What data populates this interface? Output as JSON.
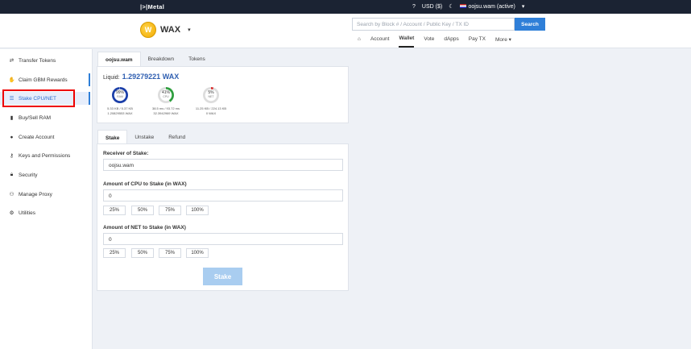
{
  "topbar": {
    "brand": "|>|Metal",
    "help_icon": "help-circle-icon",
    "currency": "USD ($)",
    "theme_icon": "moon-icon",
    "account": "oojsu.wam (active)",
    "caret": "▾"
  },
  "header": {
    "chain_name": "WAX",
    "chain_logo_letter": "W",
    "chain_caret": "▾",
    "search_placeholder": "Search by Block # / Account / Public Key / TX ID",
    "search_button": "Search",
    "nav": [
      "Account",
      "Wallet",
      "Vote",
      "dApps",
      "Pay TX",
      "More ▾"
    ],
    "nav_active": "Wallet",
    "home_icon": "home-icon"
  },
  "sidebar": {
    "items": [
      {
        "label": "Transfer Tokens",
        "icon": "transfer-icon"
      },
      {
        "label": "Claim GBM Rewards",
        "icon": "hand-icon"
      },
      {
        "label": "Stake CPU/NET",
        "icon": "list-icon"
      },
      {
        "label": "Buy/Sell RAM",
        "icon": "memory-icon"
      },
      {
        "label": "Create Account",
        "icon": "user-icon"
      },
      {
        "label": "Keys and Permissions",
        "icon": "key-icon"
      },
      {
        "label": "Security",
        "icon": "lock-icon"
      },
      {
        "label": "Manage Proxy",
        "icon": "users-icon"
      },
      {
        "label": "Utilities",
        "icon": "gear-icon"
      }
    ],
    "active": "Stake CPU/NET"
  },
  "account_panel": {
    "tabs": [
      "oojsu.wam",
      "Breakdown",
      "Tokens"
    ],
    "active_tab": "oojsu.wam",
    "liquid_label": "Liquid:",
    "liquid_value": "1.29279221 WAX",
    "gauges": [
      {
        "pct": "99%",
        "label": "RAM",
        "pct_value": 0.99,
        "color": "#1a3ea8",
        "line1": "5.33 KB / 5.37 KB",
        "line2": "1.20829553 WAX"
      },
      {
        "pct": "41%",
        "label": "CPU",
        "pct_value": 0.41,
        "color": "#2e9e3e",
        "line1": "38.5 ms / 93.72 ms",
        "line2": "32.3942969 WAX"
      },
      {
        "pct": "5%",
        "label": "NET",
        "pct_value": 0.05,
        "color": "#d93030",
        "line1": "11.25 KB / 224.13 KB",
        "line2": "0 WAX"
      }
    ]
  },
  "stake_panel": {
    "tabs": [
      "Stake",
      "Unstake",
      "Refund"
    ],
    "active_tab": "Stake",
    "receiver_label": "Receiver of Stake:",
    "receiver_value": "oojsu.wam",
    "cpu_label": "Amount of CPU to Stake (in WAX)",
    "cpu_value": "0",
    "net_label": "Amount of NET to Stake (in WAX)",
    "net_value": "0",
    "percent_buttons": [
      "25%",
      "50%",
      "75%",
      "100%"
    ],
    "stake_button": "Stake"
  }
}
